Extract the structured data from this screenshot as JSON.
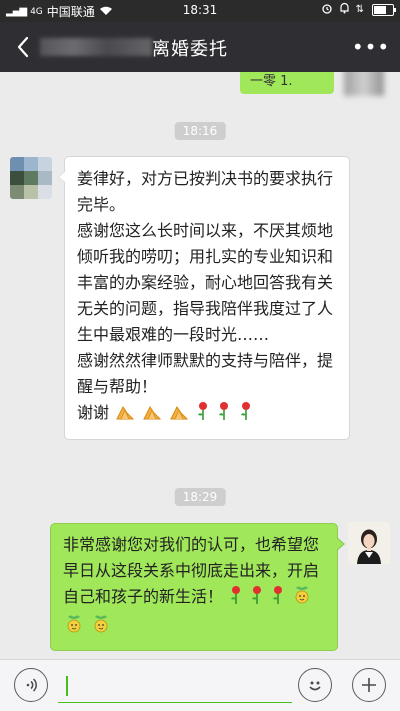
{
  "status_bar": {
    "carrier": "中国联通",
    "signal_label": "4G",
    "time": "18:31"
  },
  "nav": {
    "title": "离婚委托",
    "more_icon": "more-icon",
    "back_icon": "back-icon"
  },
  "chat": {
    "previous_bubble_text": "一零 1.",
    "messages": [
      {
        "timestamp": "18:16",
        "side": "left",
        "paragraphs": [
          "姜律好，对方已按判决书的要求执行完毕。",
          "感谢您这么长时间以来，不厌其烦地倾听我的唠叨；用扎实的专业知识和丰富的办案经验，耐心地回答我有关无关的问题，指导我陪伴我度过了人生中最艰难的一段时光……",
          "感谢然然律师默默的支持与陪伴，提醒与帮助！",
          "谢谢"
        ],
        "trailing_emojis": [
          "hands-icon",
          "hands-icon",
          "hands-icon",
          "rose-icon",
          "rose-icon",
          "rose-icon"
        ]
      },
      {
        "timestamp": "18:29",
        "side": "right",
        "text": "非常感谢您对我们的认可，也希望您早日从这段关系中彻底走出来，开启自己和孩子的新生活！",
        "trailing_emojis": [
          "rose-icon",
          "rose-icon",
          "rose-icon",
          "sprout-face-icon",
          "sprout-face-icon",
          "sprout-face-icon"
        ]
      }
    ]
  },
  "input_bar": {
    "voice_icon": "voice-icon",
    "emoji_icon": "emoji-icon",
    "plus_icon": "plus-icon",
    "value": "",
    "placeholder": ""
  },
  "colors": {
    "nav_bg": "#2f2f33",
    "chat_bg": "#ebebeb",
    "bubble_out": "#a0e75a",
    "bubble_in": "#ffffff",
    "accent": "#45c01a"
  }
}
